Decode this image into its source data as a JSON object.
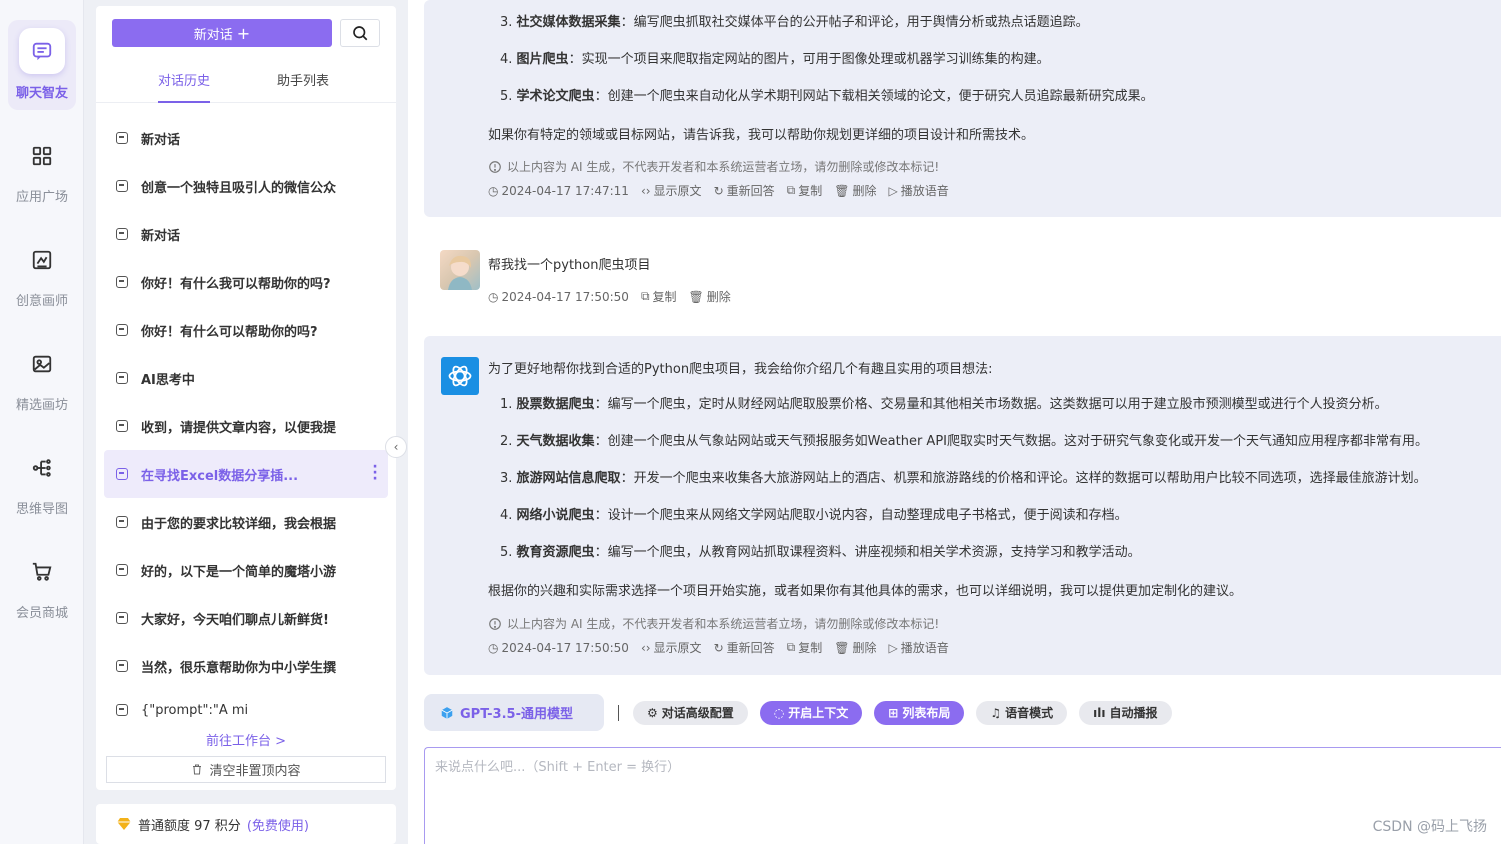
{
  "nav": {
    "items": [
      {
        "label": "聊天智友",
        "icon": "chat-icon"
      },
      {
        "label": "应用广场",
        "icon": "apps-grid-icon"
      },
      {
        "label": "创意画师",
        "icon": "draw-icon"
      },
      {
        "label": "精选画坊",
        "icon": "gallery-icon"
      },
      {
        "label": "思维导图",
        "icon": "mindmap-icon"
      },
      {
        "label": "会员商城",
        "icon": "cart-icon"
      }
    ]
  },
  "sidebar": {
    "new_chat_label": "新对话",
    "tabs": [
      "对话历史",
      "助手列表"
    ],
    "history": [
      "新对话",
      "创意一个独特且吸引人的微信公众",
      "新对话",
      "你好！有什么我可以帮助你的吗?",
      "你好！有什么可以帮助你的吗?",
      "AI思考中",
      "收到，请提供文章内容，以便我提",
      "在寻找Excel数据分享插...",
      "由于您的要求比较详细，我会根据",
      "好的，以下是一个简单的魔塔小游",
      "大家好，今天咱们聊点儿新鲜货!",
      "当然，很乐意帮助你为中小学生撰",
      "{\"prompt\":\"A mi"
    ],
    "goto_label": "前往工作台 >",
    "clear_label": "清空非置顶内容"
  },
  "quota": {
    "text": "普通额度 97 积分",
    "paid": "(免费使用)"
  },
  "chat": {
    "first_reply": {
      "items": [
        {
          "num": "3.",
          "title": "社交媒体数据采集",
          "text": "：编写爬虫抓取社交媒体平台的公开帖子和评论，用于舆情分析或热点话题追踪。"
        },
        {
          "num": "4.",
          "title": "图片爬虫",
          "text": "：实现一个项目来爬取指定网站的图片，可用于图像处理或机器学习训练集的构建。"
        },
        {
          "num": "5.",
          "title": "学术论文爬虫",
          "text": "：创建一个爬虫来自动化从学术期刊网站下载相关领域的论文，便于研究人员追踪最新研究成果。"
        }
      ],
      "closing": "如果你有特定的领域或目标网站，请告诉我，我可以帮助你规划更详细的项目设计和所需技术。",
      "disclaimer": "以上内容为 AI 生成，不代表开发者和本系统运营者立场，请勿删除或修改本标记!",
      "time": "2024-04-17 17:47:11"
    },
    "user_msg": {
      "text": "帮我找一个python爬虫项目",
      "time": "2024-04-17 17:50:50",
      "actions": [
        "复制",
        "删除"
      ]
    },
    "second_reply": {
      "intro": "为了更好地帮你找到合适的Python爬虫项目，我会给你介绍几个有趣且实用的项目想法:",
      "items": [
        {
          "num": "1.",
          "title": "股票数据爬虫",
          "text": "：编写一个爬虫，定时从财经网站爬取股票价格、交易量和其他相关市场数据。这类数据可以用于建立股市预测模型或进行个人投资分析。"
        },
        {
          "num": "2.",
          "title": "天气数据收集",
          "text": "：创建一个爬虫从气象站网站或天气预报服务如Weather API爬取实时天气数据。这对于研究气象变化或开发一个天气通知应用程序都非常有用。"
        },
        {
          "num": "3.",
          "title": "旅游网站信息爬取",
          "text": "：开发一个爬虫来收集各大旅游网站上的酒店、机票和旅游路线的价格和评论。这样的数据可以帮助用户比较不同选项，选择最佳旅游计划。"
        },
        {
          "num": "4.",
          "title": "网络小说爬虫",
          "text": "：设计一个爬虫来从网络文学网站爬取小说内容，自动整理成电子书格式，便于阅读和存档。"
        },
        {
          "num": "5.",
          "title": "教育资源爬虫",
          "text": "：编写一个爬虫，从教育网站抓取课程资料、讲座视频和相关学术资源，支持学习和教学活动。"
        }
      ],
      "closing": "根据你的兴趣和实际需求选择一个项目开始实施，或者如果你有其他具体的需求，也可以详细说明，我可以提供更加定制化的建议。",
      "disclaimer": "以上内容为 AI 生成，不代表开发者和本系统运营者立场，请勿删除或修改本标记!",
      "time": "2024-04-17 17:50:50"
    },
    "ai_actions": [
      "显示原文",
      "重新回答",
      "复制",
      "删除",
      "播放语音"
    ]
  },
  "toolbar": {
    "model": "GPT-3.5-通用模型",
    "buttons": [
      {
        "label": "对话高级配置",
        "on": false
      },
      {
        "label": "开启上下文",
        "on": true
      },
      {
        "label": "列表布局",
        "on": true
      },
      {
        "label": "语音模式",
        "on": false
      },
      {
        "label": "自动播报",
        "on": false
      }
    ]
  },
  "input": {
    "placeholder": "来说点什么吧...（Shift + Enter = 换行）"
  },
  "watermark": "CSDN @码上飞扬",
  "colors": {
    "accent": "#8b6cf0",
    "ai_bubble": "#eceef7",
    "gpt_logo": "#1a8fe3"
  }
}
